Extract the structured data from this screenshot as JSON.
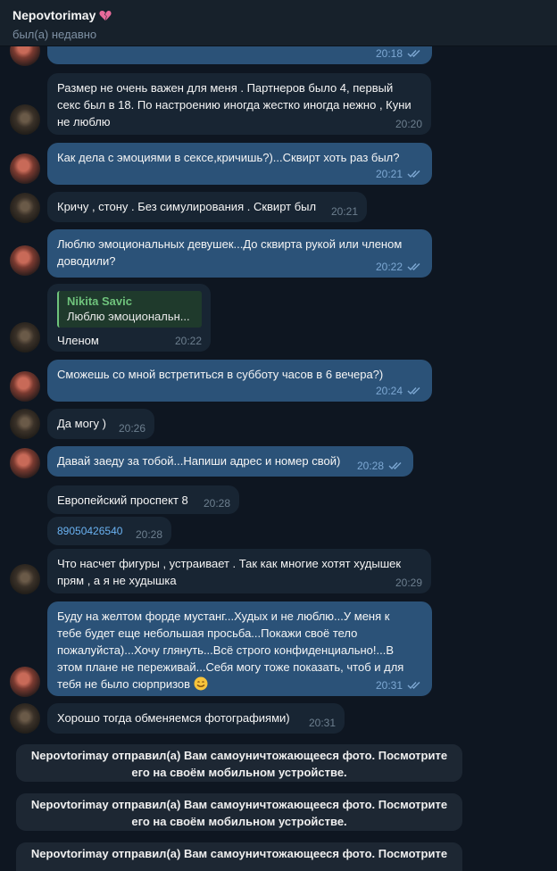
{
  "header": {
    "contact_name": "Nepovtorimay",
    "status": "был(а) недавно"
  },
  "colors": {
    "background": "#0e1621",
    "header": "#17212b",
    "outgoing_bubble": "#2b5278",
    "incoming_bubble": "#182533",
    "reply_accent": "#6fc37c",
    "link": "#6ab2f2"
  },
  "messages": [
    {
      "side": "out",
      "text": "",
      "time": "20:18"
    },
    {
      "side": "in",
      "text": "Размер не очень важен для меня . Партнеров было 4, первый секс был в 18. По настроению иногда жестко иногда нежно , Куни не люблю",
      "time": "20:20"
    },
    {
      "side": "out",
      "text": "Как дела с эмоциями в сексе,кричишь?)...Сквирт хоть раз был?",
      "time": "20:21"
    },
    {
      "side": "in",
      "text": "Кричу , стону . Без симулирования . Сквирт был",
      "time": "20:21"
    },
    {
      "side": "out",
      "text": "Люблю эмоциональных девушек...До сквирта рукой или членом доводили?",
      "time": "20:22"
    },
    {
      "side": "in",
      "reply_name": "Nikita Savic",
      "reply_text": "Люблю эмоциональн...",
      "text": "Членом",
      "time": "20:22"
    },
    {
      "side": "out",
      "text": "Сможешь со мной встретиться в субботу часов в 6 вечера?)",
      "time": "20:24"
    },
    {
      "side": "in",
      "text": "Да могу )",
      "time": "20:26"
    },
    {
      "side": "out",
      "text": "Давай заеду за тобой...Напиши адрес и номер свой)",
      "time": "20:28"
    },
    {
      "side": "in",
      "text": "Европейский проспект 8",
      "time": "20:28"
    },
    {
      "side": "in",
      "text": "89050426540",
      "time": "20:28"
    },
    {
      "side": "in",
      "text": "Что насчет фигуры , устраивает . Так как многие хотят худышек прям , а я не худышка",
      "time": "20:29"
    },
    {
      "side": "out",
      "text": "Буду на желтом форде мустанг...Худых и не люблю...У меня к тебе будет еще небольшая просьба...Покажи своё тело пожалуйста)...Хочу глянуть...Всё строго конфиденциально!...В этом плане не переживай...Себя могу тоже показать, чтоб и для тебя не было сюрпризов",
      "emoji": "smile-emoji",
      "time": "20:31"
    },
    {
      "side": "in",
      "text": "Хорошо тогда обменяемся фотографиями)",
      "time": "20:31"
    }
  ],
  "service_messages": [
    {
      "line1": "Nepovtorimay отправил(а) Вам самоуничтожающееся фото. Посмотрите",
      "line2": "его на своём мобильном устройстве."
    },
    {
      "line1": "Nepovtorimay отправил(а) Вам самоуничтожающееся фото. Посмотрите",
      "line2": "его на своём мобильном устройстве."
    },
    {
      "line1": "Nepovtorimay отправил(а) Вам самоуничтожающееся фото. Посмотрите",
      "line2": ""
    }
  ],
  "icons": {
    "heart": "broken-heart-icon",
    "read_receipt": "double-check-icon"
  }
}
